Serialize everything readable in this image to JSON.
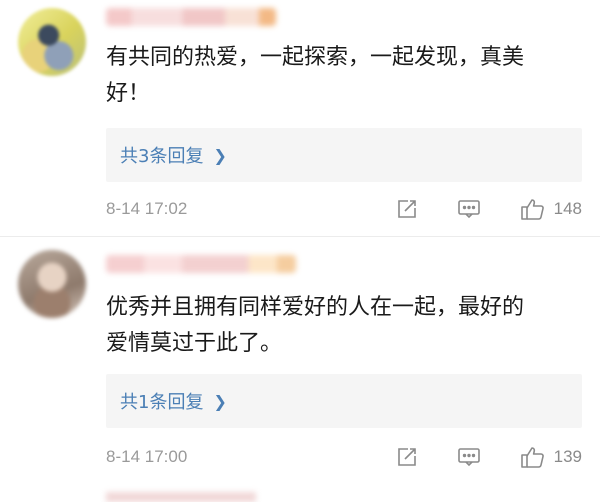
{
  "comments": [
    {
      "body_line1": "有共同的热爱，一起探索，一起发现，真美",
      "body_line2": "好！",
      "replies_label": "共3条回复",
      "timestamp": "8-14 17:02",
      "likes": "148"
    },
    {
      "body_line1": "优秀并且拥有同样爱好的人在一起，最好的",
      "body_line2": "爱情莫过于此了。",
      "replies_label": "共1条回复",
      "timestamp": "8-14 17:00",
      "likes": "139"
    }
  ],
  "icons": {
    "share": "share-icon",
    "reply": "comment-icon",
    "like": "thumbs-up-icon",
    "chevron": "chevron-right-icon"
  },
  "colors": {
    "link": "#4b7fb5",
    "meta": "#9a9a9a",
    "reply_box": "#f5f5f5"
  }
}
